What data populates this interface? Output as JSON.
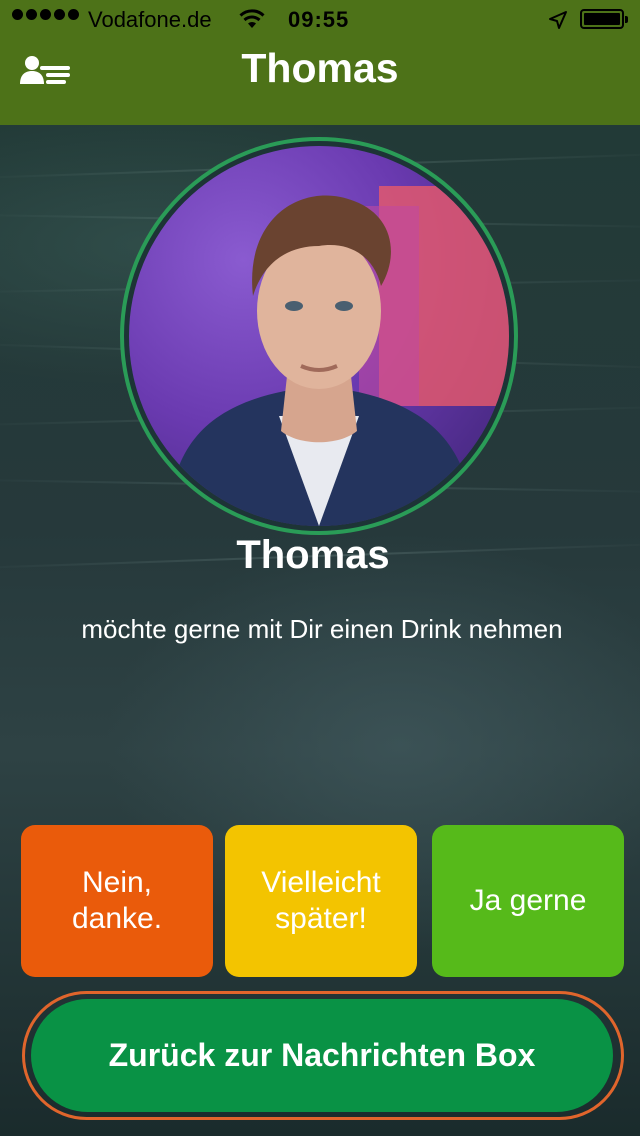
{
  "status_bar": {
    "carrier": "Vodafone.de",
    "time": "09:55"
  },
  "navbar": {
    "title": "Thomas",
    "left_icon": "contacts-icon"
  },
  "profile": {
    "name": "Thomas",
    "message": "möchte gerne mit Dir einen Drink nehmen",
    "ring_color": "#2a9c57"
  },
  "responses": [
    {
      "label": "Nein,\ndanke.",
      "color": "#ea5b0b"
    },
    {
      "label": "Vielleicht\nspäter!",
      "color": "#f3c400"
    },
    {
      "label": "Ja gerne",
      "color": "#56ba1a"
    }
  ],
  "back_button": {
    "label": "Zurück zur Nachrichten Box",
    "color": "#099245",
    "border_color": "#e0652c"
  },
  "colors": {
    "header": "#4d7218"
  }
}
